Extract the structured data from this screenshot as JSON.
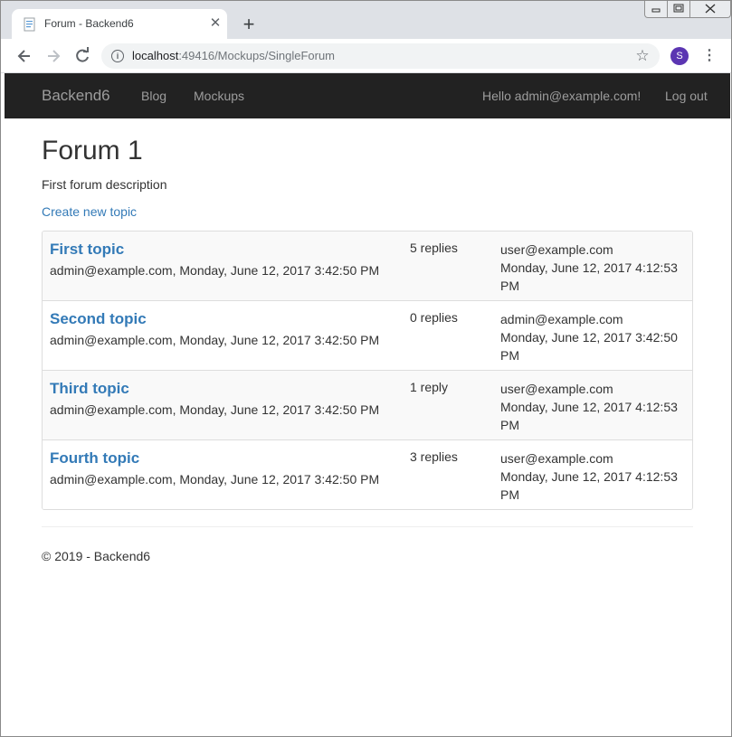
{
  "browser": {
    "tab": {
      "title": "Forum - Backend6",
      "close_glyph": "✕"
    },
    "new_tab_glyph": "+",
    "address": {
      "host": "localhost",
      "rest": ":49416/Mockups/SingleForum"
    },
    "profile_initial": "S",
    "icons": {
      "back": "back-arrow-icon",
      "forward": "forward-arrow-icon",
      "reload": "reload-icon",
      "info": "info-icon",
      "star": "star-icon",
      "menu": "kebab-menu-icon"
    },
    "colors": {
      "profile": "#5b35b2",
      "tabstrip": "#dee1e6"
    }
  },
  "navbar": {
    "brand": "Backend6",
    "links": [
      "Blog",
      "Mockups"
    ],
    "greeting": "Hello admin@example.com!",
    "logout": "Log out",
    "colors": {
      "background": "#222222",
      "text": "#9d9d9d"
    }
  },
  "forum": {
    "title": "Forum 1",
    "description": "First forum description",
    "create_topic": "Create new topic"
  },
  "topics": [
    {
      "title": "First topic",
      "meta": "admin@example.com, Monday, June 12, 2017 3:42:50 PM",
      "replies": "5 replies",
      "last_user": "user@example.com",
      "last_date": "Monday, June 12, 2017 4:12:53 PM"
    },
    {
      "title": "Second topic",
      "meta": "admin@example.com, Monday, June 12, 2017 3:42:50 PM",
      "replies": "0 replies",
      "last_user": "admin@example.com",
      "last_date": "Monday, June 12, 2017 3:42:50 PM"
    },
    {
      "title": "Third topic",
      "meta": "admin@example.com, Monday, June 12, 2017 3:42:50 PM",
      "replies": "1 reply",
      "last_user": "user@example.com",
      "last_date": "Monday, June 12, 2017 4:12:53 PM"
    },
    {
      "title": "Fourth topic",
      "meta": "admin@example.com, Monday, June 12, 2017 3:42:50 PM",
      "replies": "3 replies",
      "last_user": "user@example.com",
      "last_date": "Monday, June 12, 2017 4:12:53 PM"
    }
  ],
  "footer": {
    "text": "© 2019 - Backend6"
  },
  "colors": {
    "link": "#337ab7",
    "text": "#333333",
    "row_stripe": "#f9f9f9"
  }
}
